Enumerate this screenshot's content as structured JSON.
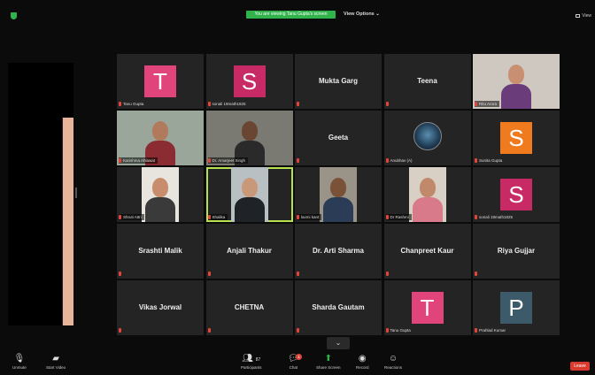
{
  "header": {
    "viewing_banner": "You are viewing Tanu Gupta's screen",
    "view_options": "View Options ⌄",
    "view_button": "View"
  },
  "grid": {
    "tiles": [
      {
        "name": "",
        "label": "Tanu Gupta",
        "avatar": "T",
        "avatar_color": "#e0447a"
      },
      {
        "name": "",
        "label": "sonali 19math1825",
        "avatar": "S",
        "avatar_color": "#c72a64"
      },
      {
        "name": "Mukta Garg",
        "label": ""
      },
      {
        "name": "Teena",
        "label": ""
      },
      {
        "name": "",
        "label": "Ritu Arora",
        "video": true
      },
      {
        "name": "",
        "label": "Karishma Ahlawat",
        "video": true
      },
      {
        "name": "",
        "label": "Dr. Amarjeet Singh",
        "video": true
      },
      {
        "name": "Geeta",
        "label": ""
      },
      {
        "name": "",
        "label": "Anubhav (A)",
        "avatar_image": true
      },
      {
        "name": "",
        "label": "Sunita Gupta",
        "avatar": "S",
        "avatar_color": "#f07b1e"
      },
      {
        "name": "",
        "label": "Shruti Attri",
        "video": true
      },
      {
        "name": "",
        "label": "Shalika",
        "video": true
      },
      {
        "name": "",
        "label": "laxmi kant",
        "video": true
      },
      {
        "name": "",
        "label": "Dr Rashmi",
        "video": true
      },
      {
        "name": "",
        "label": "sonali 19math1825",
        "avatar": "S",
        "avatar_color": "#c72a64"
      },
      {
        "name": "Srashti Malik",
        "label": ""
      },
      {
        "name": "Anjali Thakur",
        "label": ""
      },
      {
        "name": "Dr. Arti Sharma",
        "label": ""
      },
      {
        "name": "Chanpreet Kaur",
        "label": ""
      },
      {
        "name": "Riya Gujjar",
        "label": ""
      },
      {
        "name": "Vikas Jorwal",
        "label": ""
      },
      {
        "name": "CHETNA",
        "label": ""
      },
      {
        "name": "Sharda Gautam",
        "label": ""
      },
      {
        "name": "",
        "label": "Tanu Gupta",
        "avatar": "T",
        "avatar_color": "#e0447a"
      },
      {
        "name": "",
        "label": "Prahlad Kumar",
        "avatar": "P",
        "avatar_color": "#3d5a6a"
      }
    ]
  },
  "toolbar": {
    "unmute": "Unmute",
    "start_video": "Start Video",
    "participants": "Participants",
    "participants_count": "87",
    "chat": "Chat",
    "chat_badge": "1",
    "share_screen": "Share Screen",
    "record": "Record",
    "reactions": "Reactions",
    "leave": "Leave"
  },
  "colors": {
    "banner_green": "#2fb34a",
    "active_speaker": "#b7e24f",
    "leave_red": "#d83a2e"
  }
}
